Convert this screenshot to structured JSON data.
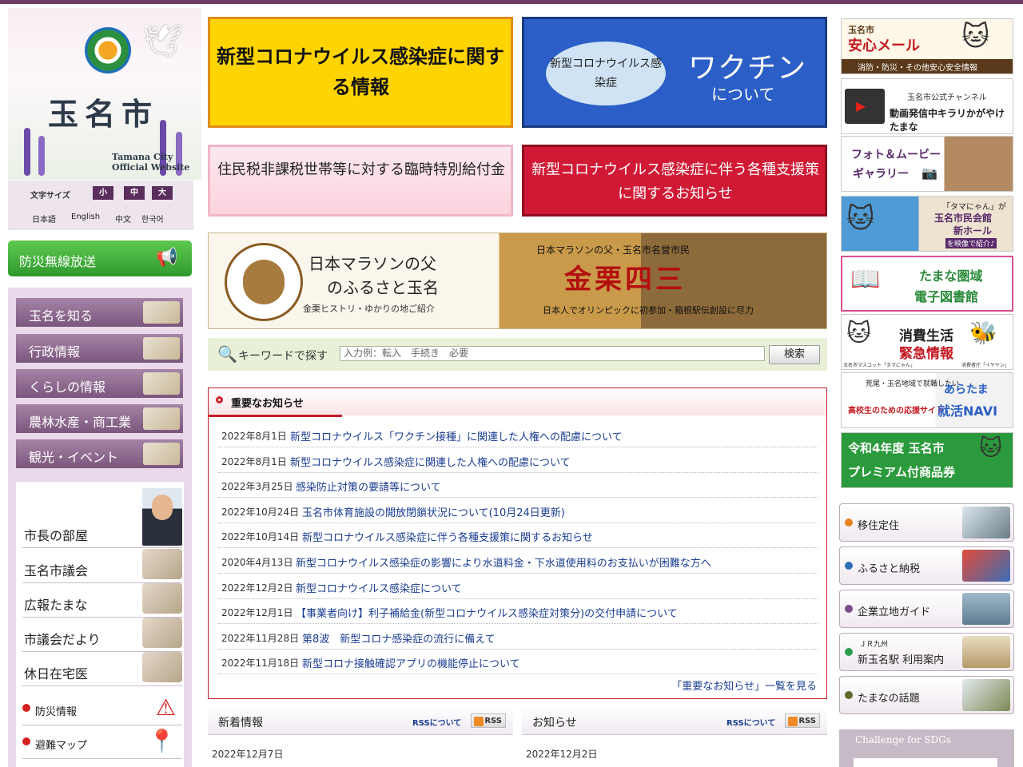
{
  "site": {
    "name": "玉名市",
    "name_en_line1": "Tamana City",
    "name_en_line2": "Official Website"
  },
  "font_size": {
    "label": "文字サイズ",
    "small": "小",
    "medium": "中",
    "large": "大"
  },
  "languages": [
    "日本語",
    "English",
    "中文",
    "한국어"
  ],
  "bousai_musen": "防災無線放送",
  "nav": [
    {
      "label": "玉名を知る"
    },
    {
      "label": "行政情報"
    },
    {
      "label": "くらしの情報"
    },
    {
      "label": "農林水産・商工業"
    },
    {
      "label": "観光・イベント"
    }
  ],
  "sub_nav": [
    "市長の部屋",
    "玉名市議会",
    "広報たまな",
    "市議会だより",
    "休日在宅医"
  ],
  "small_nav": [
    "防災情報",
    "避難マップ"
  ],
  "banners": {
    "corona_info": "新型コロナウイルス感染症に関する情報",
    "vaccine_oval": "新型コロナウイルス感染症",
    "vaccine_big": "ワクチン",
    "vaccine_sub": "について",
    "benefit": "住民税非課税世帯等に対する臨時特別給付金",
    "support": "新型コロナウイルス感染症に伴う各種支援策に関するお知らせ",
    "marathon_t1": "日本マラソンの父",
    "marathon_t2": "のふるさと玉名",
    "marathon_t3": "金栗ヒストリ・ゆかりの地ご紹介",
    "marathon_r1": "日本マラソンの父・玉名市名誉市民",
    "marathon_r2": "金栗四三",
    "marathon_r3": "日本人でオリンピックに初参加・箱根駅伝創設に尽力"
  },
  "search": {
    "label": "キーワードで探す",
    "placeholder": "入力例：転入　手続き　必要",
    "button": "検索"
  },
  "important": {
    "title": "重要なお知らせ",
    "items": [
      {
        "date": "2022年8月1日",
        "text": "新型コロナウイルス「ワクチン接種」に関連した人権への配慮について"
      },
      {
        "date": "2022年8月1日",
        "text": "新型コロナウイルス感染症に関連した人権への配慮について"
      },
      {
        "date": "2022年3月25日",
        "text": "感染防止対策の要請等について"
      },
      {
        "date": "2022年10月24日",
        "text": "玉名市体育施設の開放閉鎖状況について(10月24日更新)"
      },
      {
        "date": "2022年10月14日",
        "text": "新型コロナウイルス感染症に伴う各種支援策に関するお知らせ"
      },
      {
        "date": "2020年4月13日",
        "text": "新型コロナウイルス感染症の影響により水道料金・下水道使用料のお支払いが困難な方へ"
      },
      {
        "date": "2022年12月2日",
        "text": "新型コロナウイルス感染症について"
      },
      {
        "date": "2022年12月1日",
        "text": "【事業者向け】利子補給金(新型コロナウイルス感染症対策分)の交付申請について"
      },
      {
        "date": "2022年11月28日",
        "text": "第8波　新型コロナ感染症の流行に備えて"
      },
      {
        "date": "2022年11月18日",
        "text": "新型コロナ接触確認アプリの機能停止について"
      }
    ],
    "more": "「重要なお知らせ」一覧を見る"
  },
  "new_info": {
    "title": "新着情報",
    "rss_about": "RSSについて",
    "rss": "RSS",
    "date": "2022年12月7日"
  },
  "notices": {
    "title": "お知らせ",
    "rss_about": "RSSについて",
    "rss": "RSS",
    "date": "2022年12月2日"
  },
  "right_banners": {
    "anshin_1": "玉名市",
    "anshin_2": "安心メール",
    "anshin_3": "消防・防災・その他安心安全情報",
    "channel_1": "玉名市公式チャンネル",
    "channel_2": "動画発信中キラリかがやけたまな",
    "photo_1": "フォト＆ムービー",
    "photo_2": "ギャラリー",
    "hall_1": "「タマにゃん」が",
    "hall_2": "玉名市民会館",
    "hall_3": "新ホール",
    "hall_4": "を映像で紹介♪",
    "library_1": "たまな圏域",
    "library_2": "電子図書館",
    "consumer_1": "消費生活",
    "consumer_2": "緊急情報",
    "consumer_3": "玉名市マスコット「タマにゃん」",
    "consumer_4": "消費者庁「イヤヤン」",
    "job_1": "荒尾・玉名地域で就職したい",
    "job_2": "高校生のための応援サイト",
    "job_3": "あらたま",
    "job_4": "就活NAVI",
    "coupon_1": "令和4年度 玉名市",
    "coupon_2": "プレミアム付商品券"
  },
  "side_links": [
    {
      "label": "移住定住",
      "color": "#e8821e"
    },
    {
      "label": "ふるさと納税",
      "color": "#2f6fb6"
    },
    {
      "label": "企業立地ガイド",
      "color": "#7a4c8a"
    },
    {
      "label_line1": "ＪＲ九州",
      "label": "新玉名駅 利用案内",
      "color": "#2f9a4c"
    },
    {
      "label": "たまなの話題",
      "color": "#5f6b2a"
    }
  ],
  "sdgs": "Challenge for SDGs",
  "colors": {
    "brand_purple": "#6b3d63",
    "accent_red": "#c41b2a",
    "link_blue": "#1a3d91"
  }
}
